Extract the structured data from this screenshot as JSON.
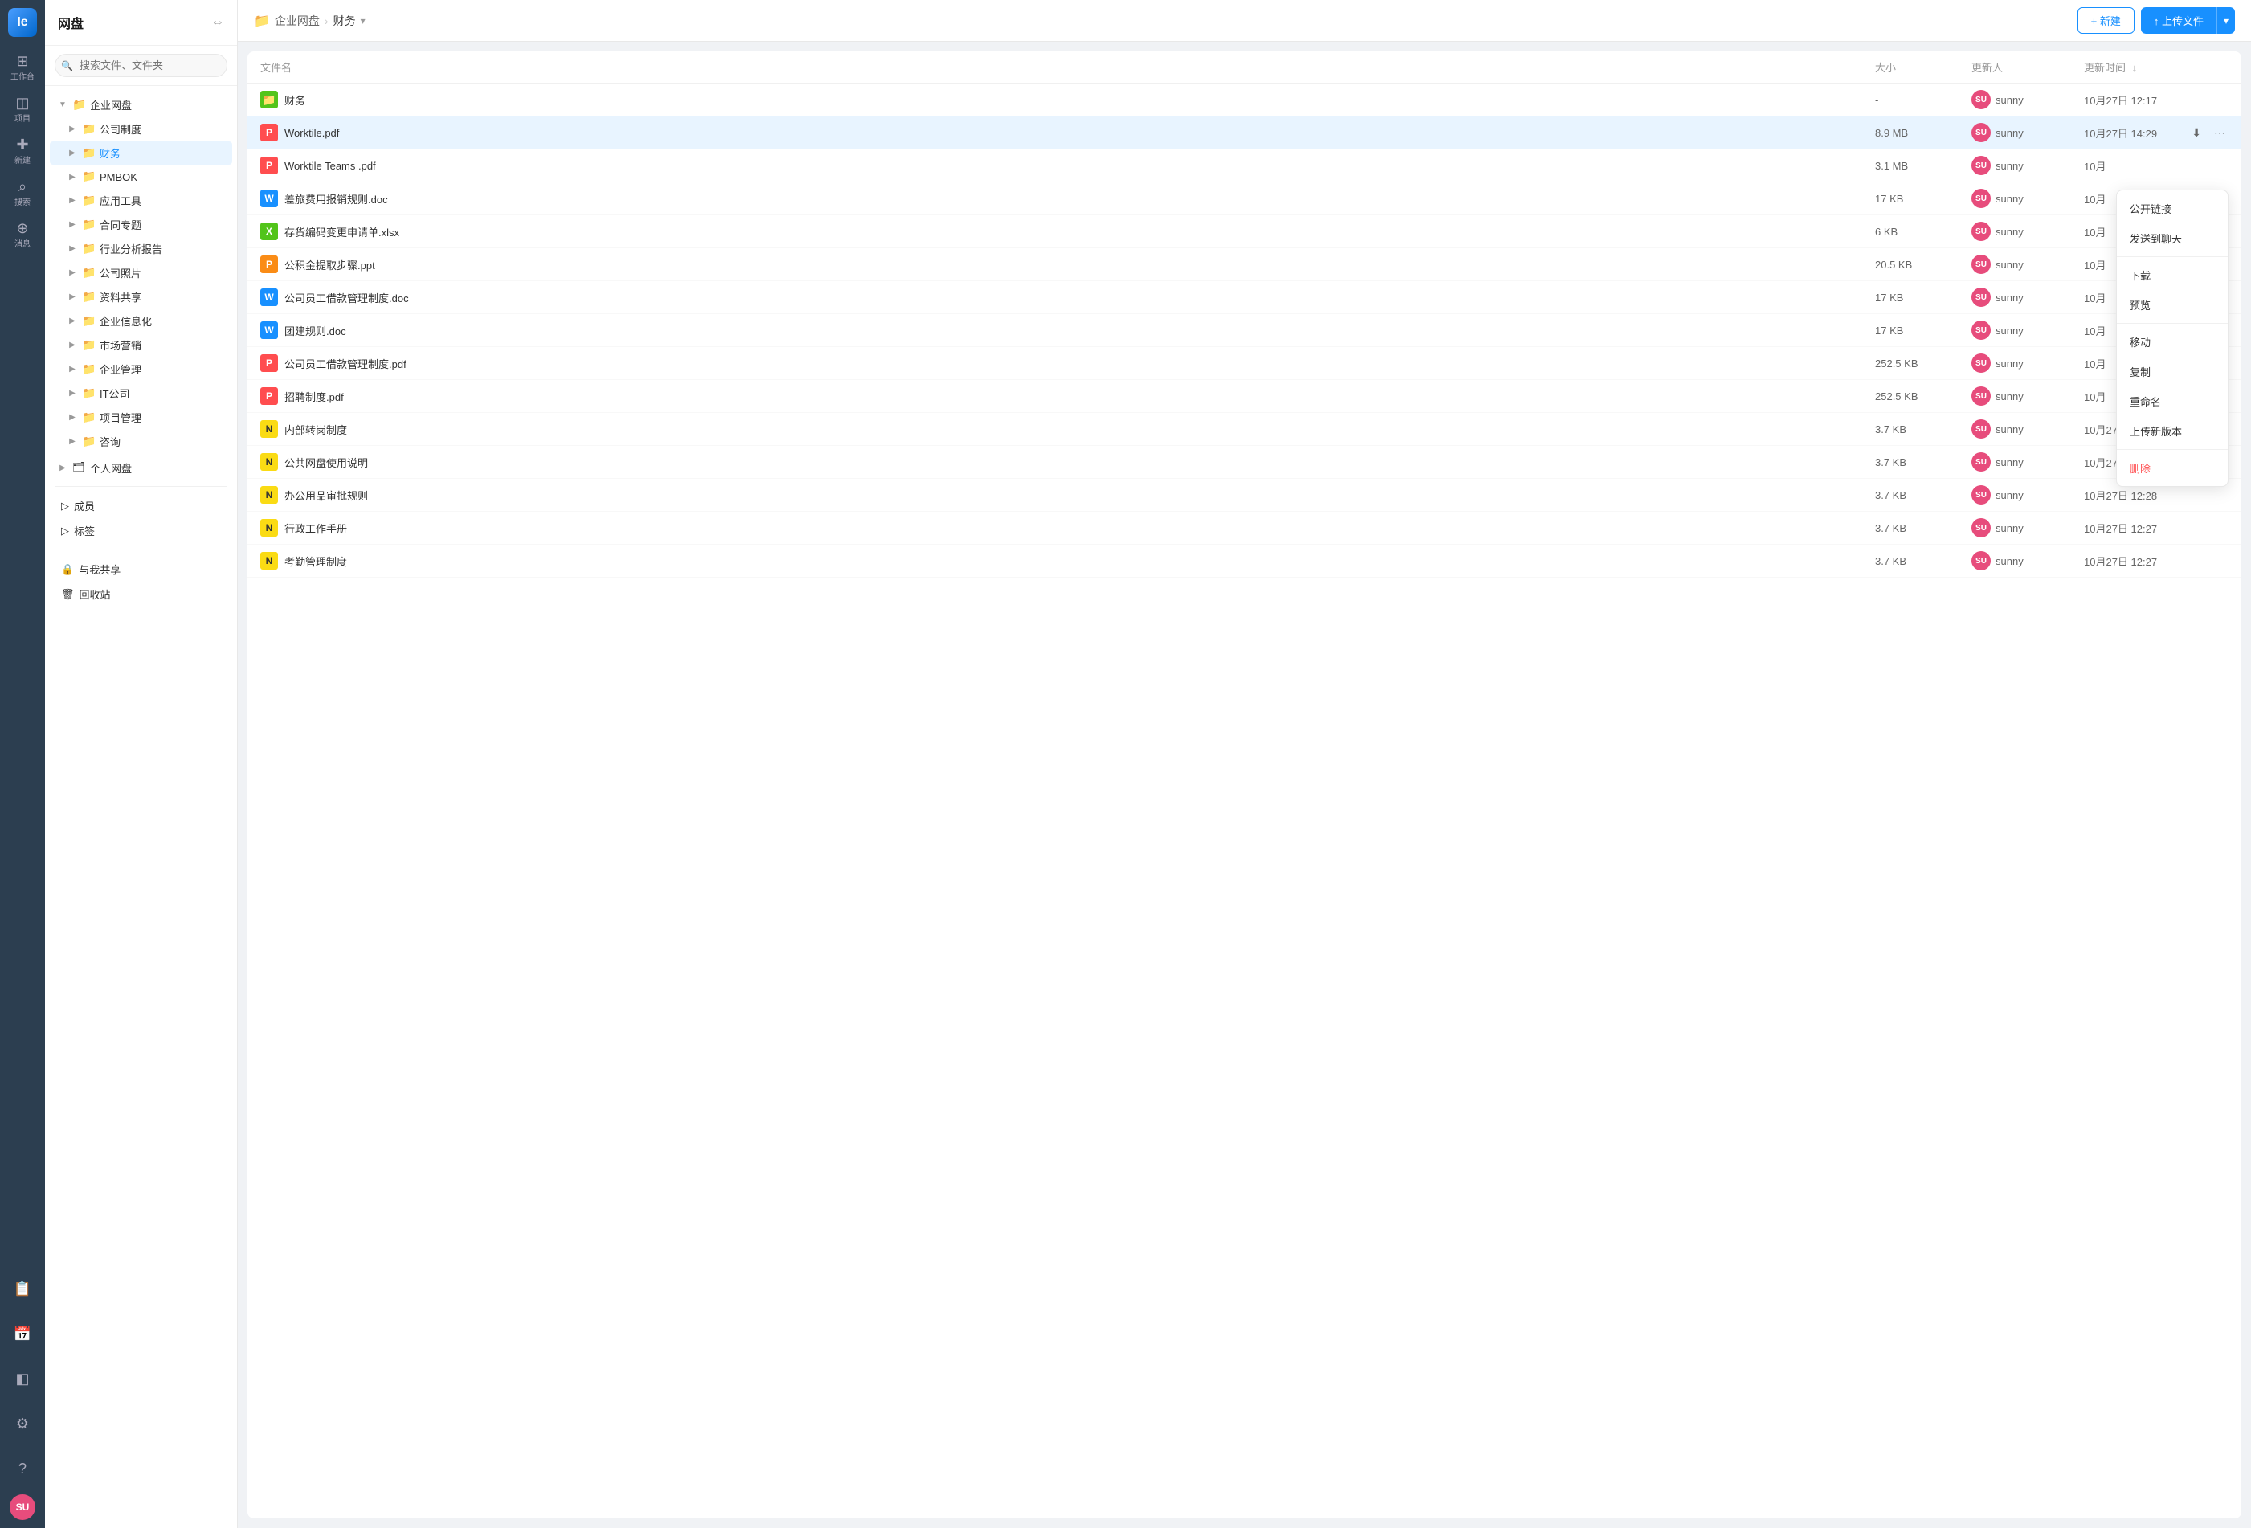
{
  "appbar": {
    "logo": "Ie",
    "items": [
      {
        "label": "工作台",
        "icon": "⊞",
        "active": false
      },
      {
        "label": "项目",
        "icon": "👤",
        "active": false
      },
      {
        "label": "新建",
        "icon": "+",
        "active": false
      },
      {
        "label": "搜索",
        "icon": "🔍",
        "active": false
      },
      {
        "label": "消息",
        "icon": "💬",
        "active": false
      }
    ],
    "bottom_items": [
      {
        "label": "📋",
        "name": "clipboard"
      },
      {
        "label": "📅",
        "name": "calendar"
      },
      {
        "label": "📦",
        "name": "box"
      },
      {
        "label": "⚙",
        "name": "settings"
      },
      {
        "label": "❓",
        "name": "help"
      }
    ],
    "avatar": "SU"
  },
  "sidebar": {
    "title": "网盘",
    "search_placeholder": "搜索文件、文件夹",
    "tree": [
      {
        "label": "企业网盘",
        "expanded": true,
        "color": "#52c41a",
        "children": [
          {
            "label": "公司制度",
            "color": "#ff7875",
            "indent": 1
          },
          {
            "label": "财务",
            "color": "#52c41a",
            "indent": 1,
            "active": true
          },
          {
            "label": "PMBOK",
            "color": "#fadb14",
            "indent": 1
          },
          {
            "label": "应用工具",
            "color": "#fadb14",
            "indent": 1
          },
          {
            "label": "合同专题",
            "color": "#fadb14",
            "indent": 1
          },
          {
            "label": "行业分析报告",
            "color": "#fadb14",
            "indent": 1
          },
          {
            "label": "公司照片",
            "color": "#4a9eff",
            "indent": 1
          },
          {
            "label": "资料共享",
            "color": "#fadb14",
            "indent": 1
          },
          {
            "label": "企业信息化",
            "color": "#4a9eff",
            "indent": 1
          },
          {
            "label": "市场营销",
            "color": "#52c41a",
            "indent": 1
          },
          {
            "label": "企业管理",
            "color": "#4a9eff",
            "indent": 1
          },
          {
            "label": "IT公司",
            "color": "#52c41a",
            "indent": 1
          },
          {
            "label": "项目管理",
            "color": "#4a9eff",
            "indent": 1
          },
          {
            "label": "咨询",
            "color": "#4a9eff",
            "indent": 1
          }
        ]
      },
      {
        "label": "个人网盘",
        "expanded": false,
        "color": "#ff7875",
        "indent": 0
      }
    ],
    "bottom_items": [
      {
        "label": "成员",
        "icon": "👥"
      },
      {
        "label": "标签",
        "icon": "🏷"
      },
      {
        "label": "与我共享",
        "icon": "🔒"
      },
      {
        "label": "回收站",
        "icon": "🗑"
      }
    ]
  },
  "breadcrumb": {
    "root": "企业网盘",
    "current": "财务",
    "root_color": "#52c41a"
  },
  "toolbar": {
    "new_label": "+ 新建",
    "upload_label": "↑ 上传文件"
  },
  "table": {
    "columns": [
      "文件名",
      "大小",
      "更新人",
      "更新时间"
    ],
    "files": [
      {
        "name": "财务",
        "type": "folder",
        "size": "-",
        "updater": "sunny",
        "time": "10月27日 12:17"
      },
      {
        "name": "Worktile.pdf",
        "type": "pdf",
        "size": "8.9 MB",
        "updater": "sunny",
        "time": "10月27日 14:29",
        "active": true
      },
      {
        "name": "Worktile Teams .pdf",
        "type": "pdf",
        "size": "3.1 MB",
        "updater": "sunny",
        "time": "10月"
      },
      {
        "name": "差旅费用报销规则.doc",
        "type": "doc",
        "size": "17 KB",
        "updater": "sunny",
        "time": "10月"
      },
      {
        "name": "存货编码变更申请单.xlsx",
        "type": "xlsx",
        "size": "6 KB",
        "updater": "sunny",
        "time": "10月"
      },
      {
        "name": "公积金提取步骤.ppt",
        "type": "ppt",
        "size": "20.5 KB",
        "updater": "sunny",
        "time": "10月"
      },
      {
        "name": "公司员工借款管理制度.doc",
        "type": "doc",
        "size": "17 KB",
        "updater": "sunny",
        "time": "10月"
      },
      {
        "name": "团建规则.doc",
        "type": "doc",
        "size": "17 KB",
        "updater": "sunny",
        "time": "10月"
      },
      {
        "name": "公司员工借款管理制度.pdf",
        "type": "pdf",
        "size": "252.5 KB",
        "updater": "sunny",
        "time": "10月"
      },
      {
        "name": "招聘制度.pdf",
        "type": "pdf",
        "size": "252.5 KB",
        "updater": "sunny",
        "time": "10月"
      },
      {
        "name": "内部转岗制度",
        "type": "txt",
        "size": "3.7 KB",
        "updater": "sunny",
        "time": "10月27日 12:29"
      },
      {
        "name": "公共网盘使用说明",
        "type": "txt",
        "size": "3.7 KB",
        "updater": "sunny",
        "time": "10月27日 12:29"
      },
      {
        "name": "办公用品审批规则",
        "type": "txt",
        "size": "3.7 KB",
        "updater": "sunny",
        "time": "10月27日 12:28"
      },
      {
        "name": "行政工作手册",
        "type": "txt",
        "size": "3.7 KB",
        "updater": "sunny",
        "time": "10月27日 12:27"
      },
      {
        "name": "考勤管理制度",
        "type": "txt",
        "size": "3.7 KB",
        "updater": "sunny",
        "time": "10月27日 12:27"
      }
    ]
  },
  "context_menu": {
    "items": [
      {
        "label": "公开链接",
        "type": "normal"
      },
      {
        "label": "发送到聊天",
        "type": "normal"
      },
      {
        "label": "下载",
        "type": "normal"
      },
      {
        "label": "预览",
        "type": "normal"
      },
      {
        "label": "移动",
        "type": "normal"
      },
      {
        "label": "复制",
        "type": "normal"
      },
      {
        "label": "重命名",
        "type": "normal"
      },
      {
        "label": "上传新版本",
        "type": "normal"
      },
      {
        "label": "删除",
        "type": "danger"
      }
    ]
  }
}
